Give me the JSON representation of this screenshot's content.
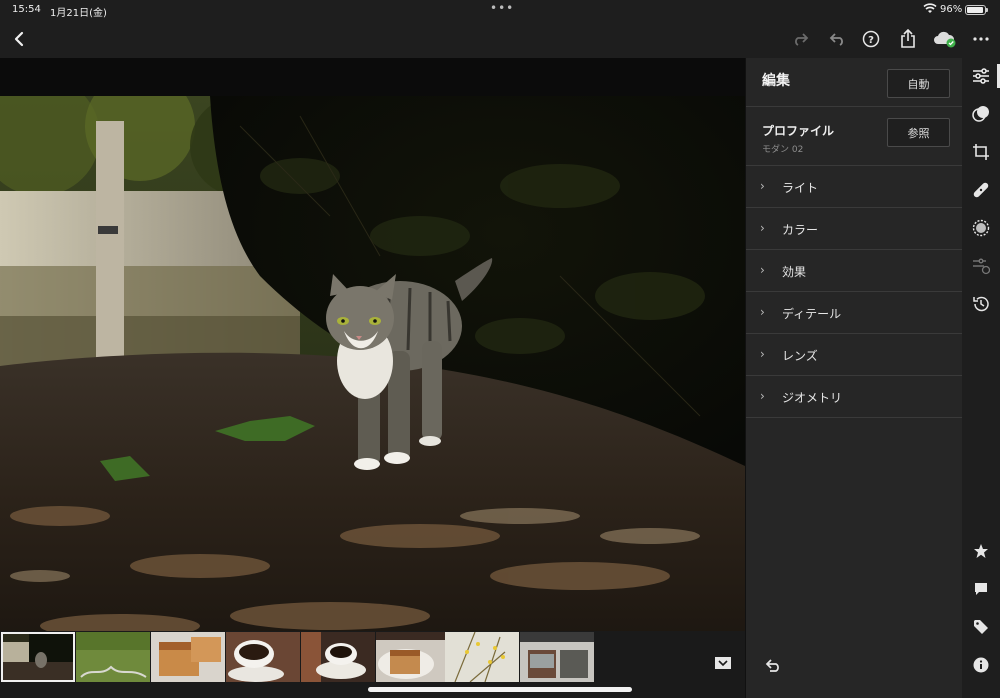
{
  "status": {
    "time": "15:54",
    "date": "1月21日(金)",
    "battery": "96%"
  },
  "panel": {
    "title": "編集",
    "auto_label": "自動",
    "profile_label": "プロファイル",
    "profile_value": "モダン 02",
    "browse_label": "参照",
    "sections": [
      {
        "label": "ライト"
      },
      {
        "label": "カラー"
      },
      {
        "label": "効果"
      },
      {
        "label": "ディテール"
      },
      {
        "label": "レンズ"
      },
      {
        "label": "ジオメトリ"
      }
    ]
  },
  "chevron": "›",
  "filmstrip": {
    "thumb_count": 8,
    "selected_index": 0
  },
  "colors": {
    "background": "#1e1e1e",
    "panel": "#262626",
    "accent_ok": "#3fb04a"
  }
}
